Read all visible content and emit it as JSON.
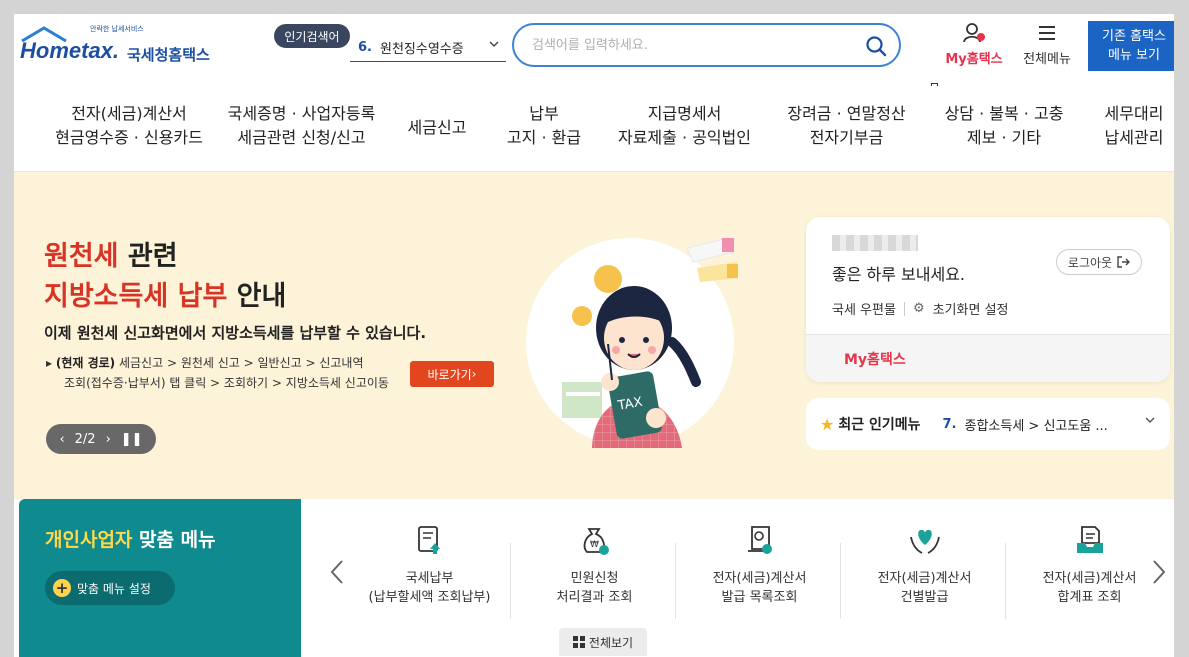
{
  "header": {
    "logo_tag": "안락한 납세서비스",
    "logo_brand": "Hometax.",
    "logo_brand_kr": "국세청홈택스",
    "popular_badge": "인기검색어",
    "popular_select": {
      "num": "6.",
      "label": "원천징수영수증"
    },
    "search_placeholder": "검색어를 입력하세요.",
    "my_hometax": "My홈택스",
    "all_menu": "전체메뉴",
    "legacy_menu": [
      "기존 홈택스",
      "메뉴 보기"
    ]
  },
  "nav": [
    [
      "전자(세금)계산서",
      "현금영수증 · 신용카드"
    ],
    [
      "국세증명 · 사업자등록",
      "세금관련 신청/신고"
    ],
    [
      "세금신고"
    ],
    [
      "납부",
      "고지 · 환급"
    ],
    [
      "지급명세서",
      "자료제출 · 공익법인"
    ],
    [
      "장려금 · 연말정산",
      "전자기부금"
    ],
    [
      "상담 · 불복 · 고충",
      "제보 · 기타"
    ],
    [
      "세무대리",
      "납세관리"
    ]
  ],
  "banner": {
    "title1_red": "원천세",
    "title1_rest": " 관련",
    "title2_red": "지방소득세 납부",
    "title2_rest": " 안내",
    "desc": "이제 원천세 신고화면에서 지방소득세를 납부할 수 있습니다.",
    "path_label": "(현재 경로)",
    "path_line1": " 세금신고 > 원천세 신고 > 일반신고 > 신고내역",
    "path_line2": "조회(접수증·납부서) 탭 클릭 > 조회하기 > 지방소득세 신고이동",
    "goto_label": "바로가기",
    "pager": "2/2",
    "tax_label": "TAX"
  },
  "user_card": {
    "greeting": "좋은 하루 보내세요.",
    "logout": "로그아웃",
    "mail": "국세 우편물",
    "init_setting": "초기화면 설정",
    "my_hometax": "My홈택스"
  },
  "recent": {
    "title": "최근 인기메뉴",
    "num": "7.",
    "text": "종합소득세 > 신고도움 ..."
  },
  "biz": {
    "title_yellow": "개인사업자",
    "title_rest": " 맞춤 메뉴",
    "setting": "맞춤 메뉴 설정"
  },
  "quick_items": [
    {
      "line1": "국세납부",
      "line2": "(납부할세액 조회납부)",
      "icon": "tax-payment-icon"
    },
    {
      "line1": "민원신청",
      "line2": "처리결과 조회",
      "icon": "money-bag-icon"
    },
    {
      "line1": "전자(세금)계산서",
      "line2": "발급 목록조회",
      "icon": "invoice-list-icon"
    },
    {
      "line1": "전자(세금)계산서",
      "line2": "건별발급",
      "icon": "heart-hands-icon"
    },
    {
      "line1": "전자(세금)계산서",
      "line2": "합계표 조회",
      "icon": "tray-document-icon"
    }
  ],
  "view_all": "전체보기",
  "colors": {
    "brand_blue": "#1c4fa3",
    "accent_red": "#e5344c",
    "banner_bg": "#fcf3d8",
    "teal": "#0f8a8e"
  }
}
